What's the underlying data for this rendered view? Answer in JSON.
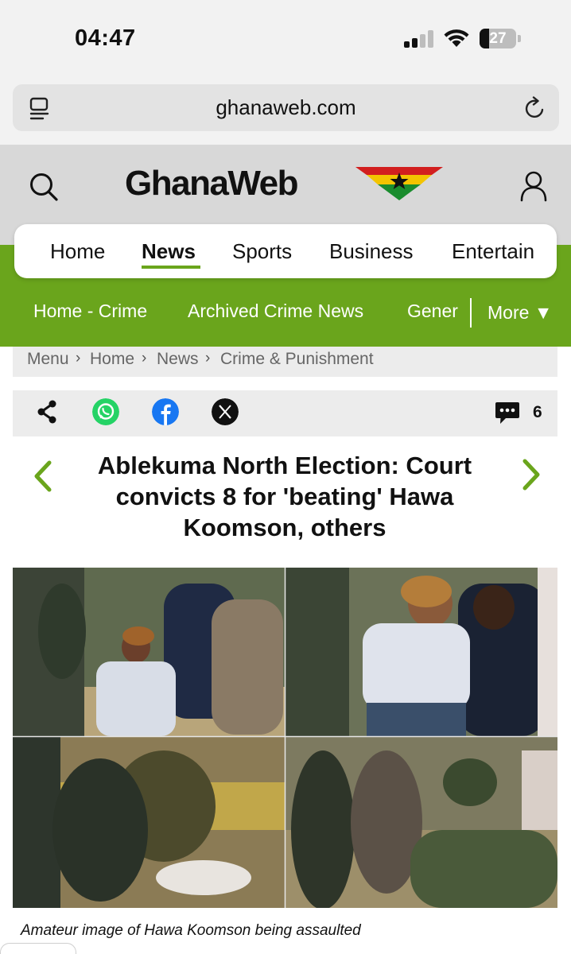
{
  "status_bar": {
    "time": "04:47",
    "battery": "27",
    "battery_level": 0.27
  },
  "browser": {
    "url": "ghanaweb.com"
  },
  "site": {
    "logo_text": "GhanaWeb",
    "brand_color": "#6aa51c"
  },
  "main_nav": {
    "items": [
      "Home",
      "News",
      "Sports",
      "Business",
      "Entertain"
    ],
    "active": "News"
  },
  "sub_nav": {
    "items": [
      "Home - Crime",
      "Archived Crime News",
      "Gener"
    ],
    "more_label": "More ▼"
  },
  "breadcrumb": {
    "items": [
      "Menu",
      "Home",
      "News",
      "Crime & Punishment"
    ],
    "separator": "›"
  },
  "share": {
    "icons": [
      "share-icon",
      "whatsapp-icon",
      "facebook-icon",
      "x-icon",
      "comment-icon"
    ],
    "comment_count": "6"
  },
  "article": {
    "headline": "Ablekuma North Election: Court convicts 8 for 'beating' Hawa Koomson, others",
    "image_caption": "Amateur image of Hawa Koomson being assaulted"
  }
}
